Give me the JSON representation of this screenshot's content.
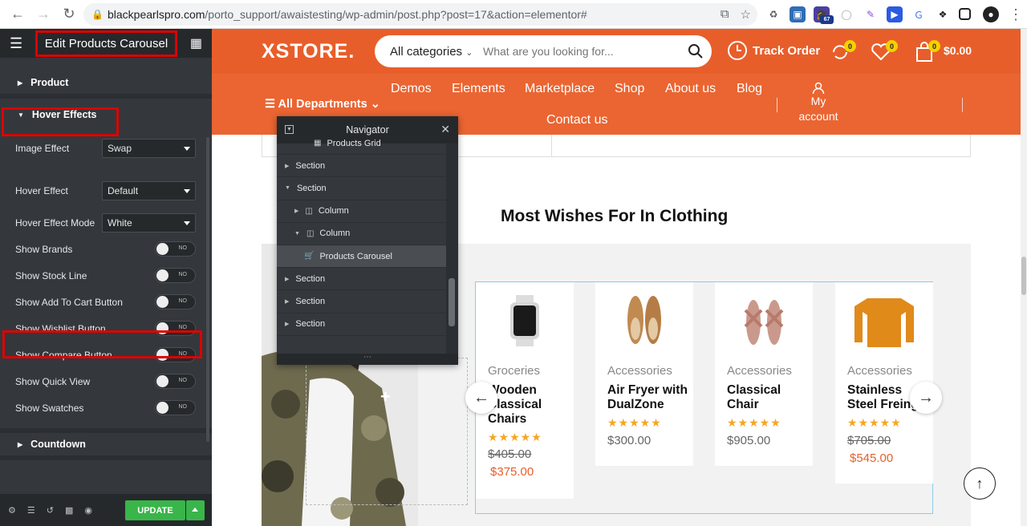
{
  "browser": {
    "url_domain": "blackpearlspro.com",
    "url_path": "/porto_support/awaistesting/wp-admin/post.php?post=17&action=elementor#",
    "ext_badge": "67"
  },
  "sidebar": {
    "title": "Edit Products Carousel",
    "sections": {
      "product": "Product",
      "hover_effects": "Hover Effects",
      "countdown": "Countdown"
    },
    "controls": [
      {
        "label": "Image Effect",
        "value": "Swap"
      },
      {
        "label": "Hover Effect",
        "value": "Default"
      },
      {
        "label": "Hover Effect Mode",
        "value": "White"
      }
    ],
    "toggles": [
      {
        "label": "Show Brands",
        "state": "NO"
      },
      {
        "label": "Show Stock Line",
        "state": "NO"
      },
      {
        "label": "Show Add To Cart Button",
        "state": "NO"
      },
      {
        "label": "Show Wishlist Button",
        "state": "NO"
      },
      {
        "label": "Show Compare Button",
        "state": "NO"
      },
      {
        "label": "Show Quick View",
        "state": "NO"
      },
      {
        "label": "Show Swatches",
        "state": "NO"
      }
    ],
    "update_label": "UPDATE"
  },
  "site": {
    "logo": "XSTORE.",
    "search": {
      "category": "All categories",
      "placeholder": "What are you looking for..."
    },
    "track_order": "Track Order",
    "compare_count": "0",
    "wishlist_count": "0",
    "cart_count": "0",
    "cart_total": "$0.00",
    "menu": [
      "Demos",
      "Elements",
      "Marketplace",
      "Shop",
      "About us",
      "Blog",
      "Contact us"
    ],
    "departments": "All Departments",
    "account": {
      "line1": "My",
      "line2": "account"
    },
    "section_heading": "Most Wishes For In Clothing",
    "products": [
      {
        "category": "Groceries",
        "name": "Wooden Classical Chairs",
        "old_price": "$405.00",
        "price": "$375.00",
        "rating": 5,
        "icon": "watch-icon"
      },
      {
        "category": "Accessories",
        "name": "Air Fryer with DualZone",
        "price": "$300.00",
        "rating": 5,
        "icon": "shoes-icon"
      },
      {
        "category": "Accessories",
        "name": "Classical Chair",
        "price": "$905.00",
        "rating": 5,
        "icon": "sandals-icon"
      },
      {
        "category": "Accessories",
        "name": "Stainless Steel Freing",
        "old_price": "$705.00",
        "price": "$545.00",
        "rating": 5,
        "icon": "sweater-icon"
      }
    ]
  },
  "navigator": {
    "title": "Navigator",
    "items": [
      {
        "label": "Products Grid",
        "level": 3,
        "type": "widget"
      },
      {
        "label": "Section",
        "level": 0,
        "type": "section",
        "expanded": false
      },
      {
        "label": "Section",
        "level": 0,
        "type": "section",
        "expanded": true
      },
      {
        "label": "Column",
        "level": 1,
        "type": "column",
        "expanded": false
      },
      {
        "label": "Column",
        "level": 1,
        "type": "column",
        "expanded": true
      },
      {
        "label": "Products Carousel",
        "level": 2,
        "type": "widget",
        "active": true
      },
      {
        "label": "Section",
        "level": 0,
        "type": "section",
        "expanded": false
      },
      {
        "label": "Section",
        "level": 0,
        "type": "section",
        "expanded": false
      },
      {
        "label": "Section",
        "level": 0,
        "type": "section",
        "expanded": false
      },
      {
        "label": "Section",
        "level": 0,
        "type": "section",
        "expanded": false
      }
    ]
  },
  "colors": {
    "brand_orange": "#e85e2a",
    "elementor_dark": "#34383c",
    "update_green": "#39b54a",
    "star": "#f5a623",
    "highlight_red": "#dd0000"
  }
}
